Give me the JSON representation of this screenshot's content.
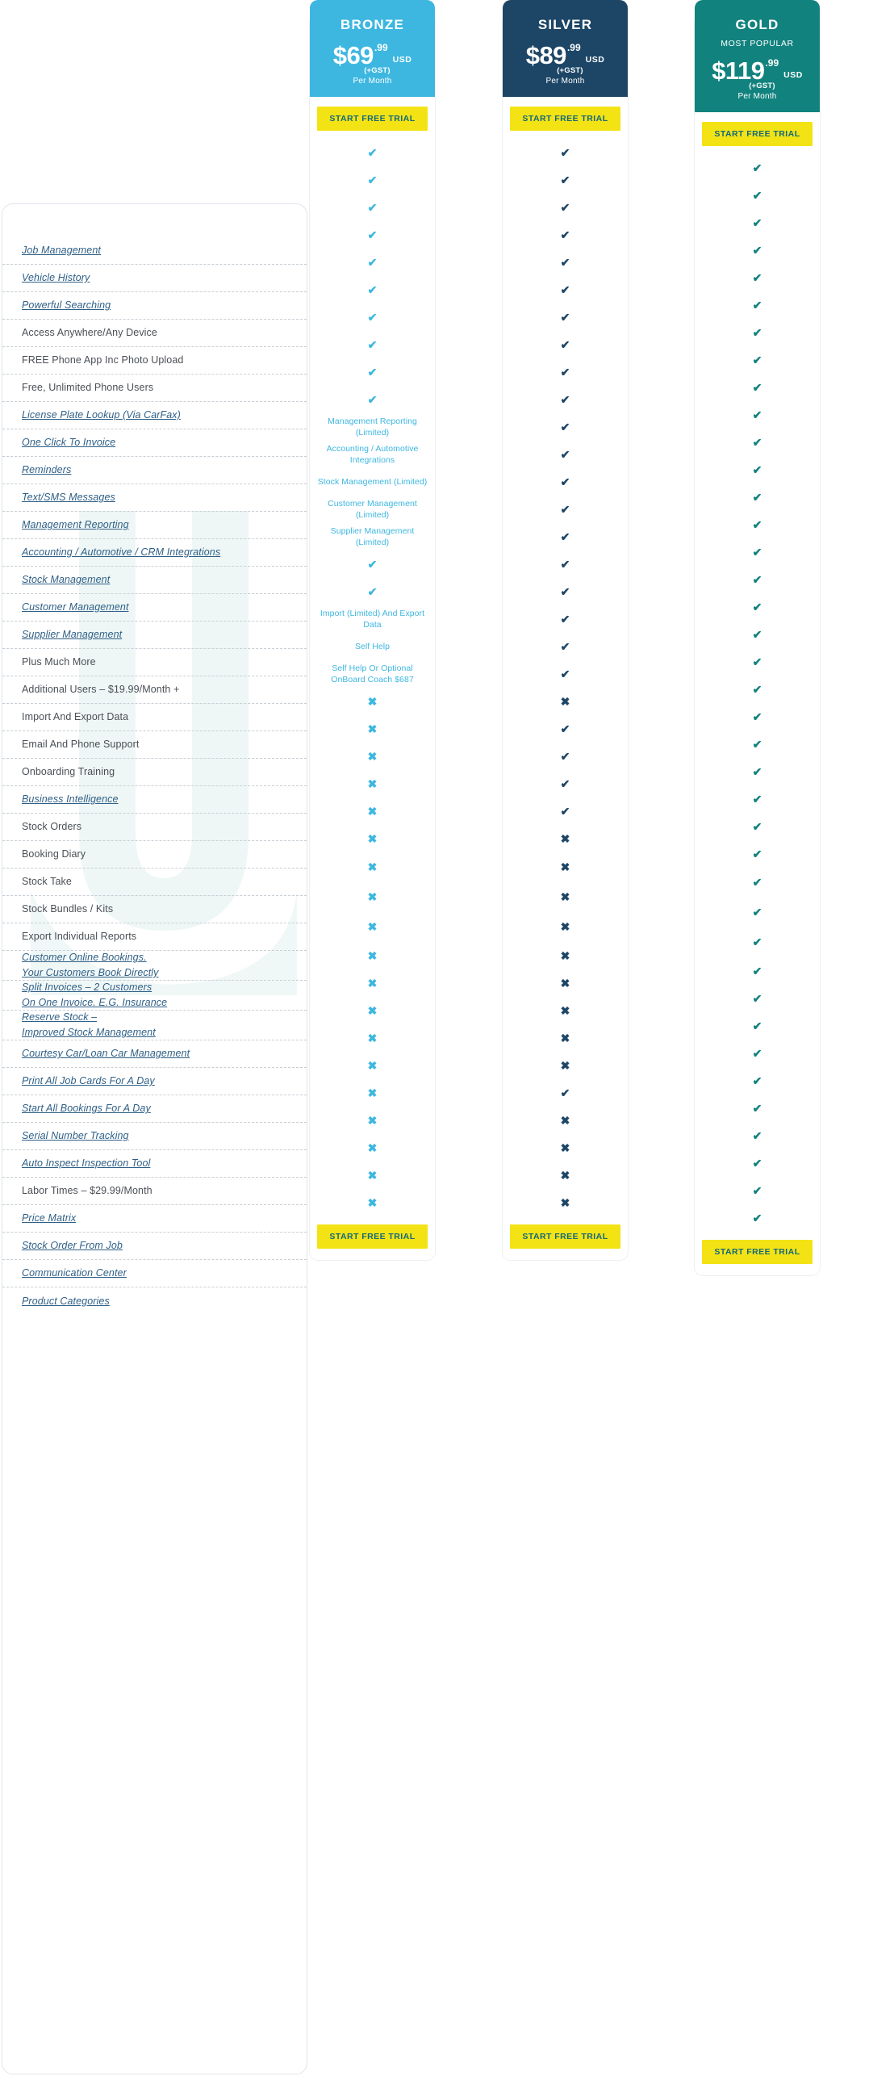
{
  "colors": {
    "bronze": "#3db7e0",
    "silver": "#1d4666",
    "gold": "#12827e",
    "cta_bg": "#f3e315",
    "cta_text": "#13687a",
    "link": "#2e5f86",
    "plain": "#4a4f55"
  },
  "cta_label": "START FREE TRIAL",
  "plans": [
    {
      "key": "bronze",
      "name": "BRONZE",
      "subtitle": "",
      "currency_symbol": "$",
      "price_whole": "69",
      "price_cents": ".99",
      "currency": "USD",
      "gst_note": "(+GST)",
      "period": "Per Month"
    },
    {
      "key": "silver",
      "name": "SILVER",
      "subtitle": "",
      "currency_symbol": "$",
      "price_whole": "89",
      "price_cents": ".99",
      "currency": "USD",
      "gst_note": "(+GST)",
      "period": "Per Month"
    },
    {
      "key": "gold",
      "name": "GOLD",
      "subtitle": "MOST POPULAR",
      "currency_symbol": "$",
      "price_whole": "119",
      "price_cents": ".99",
      "currency": "USD",
      "gst_note": "(+GST)",
      "period": "Per Month"
    }
  ],
  "icons": {
    "check": "✔",
    "cross": "✖"
  },
  "rows": [
    {
      "label": "Job Management",
      "link": true,
      "h": 34,
      "bronze": "check",
      "silver": "check",
      "gold": "check"
    },
    {
      "label": "Vehicle History",
      "link": true,
      "h": 34,
      "bronze": "check",
      "silver": "check",
      "gold": "check"
    },
    {
      "label": "Powerful Searching",
      "link": true,
      "h": 34,
      "bronze": "check",
      "silver": "check",
      "gold": "check"
    },
    {
      "label": "Access Anywhere/Any Device",
      "link": false,
      "h": 34,
      "bronze": "check",
      "silver": "check",
      "gold": "check"
    },
    {
      "label": "FREE Phone App Inc Photo Upload",
      "link": false,
      "h": 34,
      "bronze": "check",
      "silver": "check",
      "gold": "check"
    },
    {
      "label": "Free, Unlimited Phone Users",
      "link": false,
      "h": 34,
      "bronze": "check",
      "silver": "check",
      "gold": "check"
    },
    {
      "label": "License Plate Lookup (Via CarFax)",
      "link": true,
      "h": 34,
      "bronze": "check",
      "silver": "check",
      "gold": "check"
    },
    {
      "label": "One Click To Invoice",
      "link": true,
      "h": 34,
      "bronze": "check",
      "silver": "check",
      "gold": "check"
    },
    {
      "label": "Reminders",
      "link": true,
      "h": 34,
      "bronze": "check",
      "silver": "check",
      "gold": "check"
    },
    {
      "label": "Text/SMS Messages",
      "link": true,
      "h": 34,
      "bronze": "check",
      "silver": "check",
      "gold": "check"
    },
    {
      "label": "Management Reporting",
      "link": true,
      "h": 34,
      "bronze": "Management Reporting (Limited)",
      "silver": "check",
      "gold": "check"
    },
    {
      "label": "Accounting / Automotive / CRM Integrations",
      "link": true,
      "h": 34,
      "bronze": "Accounting / Automotive Integrations",
      "silver": "check",
      "gold": "check"
    },
    {
      "label": "Stock Management",
      "link": true,
      "h": 34,
      "bronze": "Stock Management (Limited)",
      "silver": "check",
      "gold": "check"
    },
    {
      "label": "Customer Management",
      "link": true,
      "h": 34,
      "bronze": "Customer Management (Limited)",
      "silver": "check",
      "gold": "check"
    },
    {
      "label": "Supplier Management",
      "link": true,
      "h": 34,
      "bronze": "Supplier Management (Limited)",
      "silver": "check",
      "gold": "check"
    },
    {
      "label": "Plus Much More",
      "link": false,
      "h": 34,
      "bronze": "check",
      "silver": "check",
      "gold": "check"
    },
    {
      "label": "Additional Users – $19.99/Month +",
      "link": false,
      "h": 34,
      "bronze": "check",
      "silver": "check",
      "gold": "check"
    },
    {
      "label": "Import And Export Data",
      "link": false,
      "h": 34,
      "bronze": "Import (Limited) And Export Data",
      "silver": "check",
      "gold": "check"
    },
    {
      "label": "Email And Phone Support",
      "link": false,
      "h": 34,
      "bronze": "Self Help",
      "silver": "check",
      "gold": "check"
    },
    {
      "label": "Onboarding Training",
      "link": false,
      "h": 34,
      "bronze": "Self Help Or Optional OnBoard Coach $687",
      "silver": "check",
      "gold": "check"
    },
    {
      "label": "Business Intelligence",
      "link": true,
      "h": 34,
      "bronze": "cross",
      "silver": "cross",
      "gold": "check"
    },
    {
      "label": "Stock Orders",
      "link": false,
      "h": 34,
      "bronze": "cross",
      "silver": "check",
      "gold": "check"
    },
    {
      "label": "Booking Diary",
      "link": false,
      "h": 34,
      "bronze": "cross",
      "silver": "check",
      "gold": "check"
    },
    {
      "label": "Stock Take",
      "link": false,
      "h": 34,
      "bronze": "cross",
      "silver": "check",
      "gold": "check"
    },
    {
      "label": "Stock Bundles / Kits",
      "link": false,
      "h": 34,
      "bronze": "cross",
      "silver": "check",
      "gold": "check"
    },
    {
      "label": "Export Individual Reports",
      "link": false,
      "h": 34,
      "bronze": "cross",
      "silver": "cross",
      "gold": "check"
    },
    {
      "label": "Customer Online Bookings.\nYour Customers Book Directly",
      "link": true,
      "h": 37,
      "bronze": "cross",
      "silver": "cross",
      "gold": "check"
    },
    {
      "label": "Split Invoices – 2 Customers\nOn One Invoice. E.G. Insurance",
      "link": true,
      "h": 37,
      "bronze": "cross",
      "silver": "cross",
      "gold": "check"
    },
    {
      "label": "Reserve Stock –\nImproved Stock Management",
      "link": true,
      "h": 37,
      "bronze": "cross",
      "silver": "cross",
      "gold": "check"
    },
    {
      "label": "Courtesy Car/Loan Car Management",
      "link": true,
      "h": 34,
      "bronze": "cross",
      "silver": "cross",
      "gold": "check"
    },
    {
      "label": "Print All Job Cards For A Day",
      "link": true,
      "h": 34,
      "bronze": "cross",
      "silver": "cross",
      "gold": "check"
    },
    {
      "label": "Start All Bookings For A Day",
      "link": true,
      "h": 34,
      "bronze": "cross",
      "silver": "cross",
      "gold": "check"
    },
    {
      "label": "Serial Number Tracking",
      "link": true,
      "h": 34,
      "bronze": "cross",
      "silver": "cross",
      "gold": "check"
    },
    {
      "label": "Auto Inspect Inspection Tool",
      "link": true,
      "h": 34,
      "bronze": "cross",
      "silver": "cross",
      "gold": "check"
    },
    {
      "label": "Labor Times – $29.99/Month",
      "link": false,
      "h": 34,
      "bronze": "cross",
      "silver": "check",
      "gold": "check"
    },
    {
      "label": "Price Matrix",
      "link": true,
      "h": 34,
      "bronze": "cross",
      "silver": "cross",
      "gold": "check"
    },
    {
      "label": "Stock Order From Job",
      "link": true,
      "h": 34,
      "bronze": "cross",
      "silver": "cross",
      "gold": "check"
    },
    {
      "label": "Communication Center",
      "link": true,
      "h": 34,
      "bronze": "cross",
      "silver": "cross",
      "gold": "check"
    },
    {
      "label": "Product Categories",
      "link": true,
      "h": 34,
      "bronze": "cross",
      "silver": "cross",
      "gold": "check"
    }
  ]
}
